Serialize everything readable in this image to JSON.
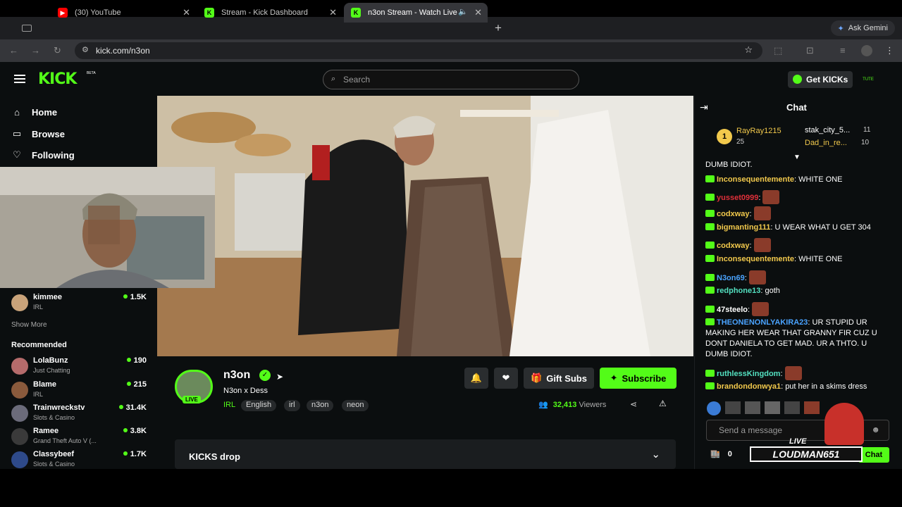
{
  "os": {
    "apple_glyph": ""
  },
  "browser": {
    "tabs": [
      {
        "title": "(30) YouTube",
        "favicon": "youtube-icon",
        "active": false
      },
      {
        "title": "Stream - Kick Dashboard",
        "favicon": "kick-icon",
        "active": false
      },
      {
        "title": "n3on Stream - Watch Live",
        "favicon": "kick-icon",
        "active": true
      }
    ],
    "new_tab": "+",
    "gemini_label": "Ask Gemini",
    "url": "kick.com/n3on"
  },
  "header": {
    "logo": "KICK",
    "logo_badge": "BETA",
    "search_placeholder": "Search",
    "get_kicks_label": "Get KICKs"
  },
  "sidebar": {
    "nav": [
      {
        "label": "Home",
        "icon": "home-icon"
      },
      {
        "label": "Browse",
        "icon": "browse-icon"
      },
      {
        "label": "Following",
        "icon": "heart-icon"
      }
    ],
    "following_channels": [
      {
        "name": "kimmee",
        "category": "IRL",
        "viewers": "1.5K"
      }
    ],
    "show_more": "Show More",
    "recommended_title": "Recommended",
    "recommended": [
      {
        "name": "LolaBunz",
        "category": "Just Chatting",
        "viewers": "190"
      },
      {
        "name": "Blame",
        "category": "IRL",
        "viewers": "215"
      },
      {
        "name": "Trainwreckstv",
        "category": "Slots & Casino",
        "viewers": "31.4K"
      },
      {
        "name": "Ramee",
        "category": "Grand Theft Auto V (...",
        "viewers": "3.8K"
      },
      {
        "name": "Classybeef",
        "category": "Slots & Casino",
        "viewers": "1.7K"
      }
    ]
  },
  "stream": {
    "streamer": "n3on",
    "live_badge": "LIVE",
    "title": "N3on x Dess",
    "category": "IRL",
    "tags": [
      "English",
      "irl",
      "n3on",
      "neon"
    ],
    "viewers_count": "32,413",
    "viewers_label": "Viewers",
    "gift_subs_label": "Gift Subs",
    "subscribe_label": "Subscribe",
    "kicks_drop_label": "KICKS drop"
  },
  "chat": {
    "title": "Chat",
    "leaderboard": [
      {
        "rank": "1",
        "name": "RayRay1215",
        "count": "25"
      },
      {
        "name": "stak_city_5...",
        "count": "11"
      },
      {
        "name": "Dad_in_re...",
        "count": "10"
      }
    ],
    "messages": [
      {
        "user": "",
        "text": "DUMB IDIOT.",
        "color": "#ffffff"
      },
      {
        "user": "Inconsequentemente",
        "text": "WHITE ONE",
        "color": "#f2c94c"
      },
      {
        "user": "yusset0999",
        "text": "",
        "color": "#e0303a",
        "emote": true
      },
      {
        "user": "codxway",
        "text": "",
        "color": "#f2c94c",
        "emote": true
      },
      {
        "user": "bigmanting111",
        "text": "U WEAR WHAT U GET 304",
        "color": "#f2c94c"
      },
      {
        "user": "codxway",
        "text": "",
        "color": "#f2c94c",
        "emote": true
      },
      {
        "user": "Inconsequentemente",
        "text": "WHITE ONE",
        "color": "#f2c94c"
      },
      {
        "user": "N3on69",
        "text": "",
        "color": "#4aa3ff",
        "emote": true
      },
      {
        "user": "redphone13",
        "text": "goth",
        "color": "#53e0c0"
      },
      {
        "user": "47steelo",
        "text": "",
        "color": "#ffffff",
        "emote": true
      },
      {
        "user": "THEONENONLYAKIRA23",
        "text": "UR STUPID UR MAKING HER WEAR THAT GRANNY FIR CUZ U DONT DANIELA TO GET MAD. UR A THTO. U DUMB IDIOT.",
        "color": "#4aa3ff"
      },
      {
        "user": "ruthlessKingdom",
        "text": "",
        "color": "#53e0c0",
        "emote": true
      },
      {
        "user": "brandondonwya1",
        "text": "put her in a skims dress",
        "color": "#f2c94c"
      }
    ],
    "input_placeholder": "Send a message",
    "kicks_balance": "0",
    "send_label": "Chat"
  },
  "overlay": {
    "live_tag": "LIVE",
    "channel_name": "LOUDMAN651"
  },
  "colors": {
    "brand": "#53fc18",
    "bg": "#0b0e0f"
  }
}
